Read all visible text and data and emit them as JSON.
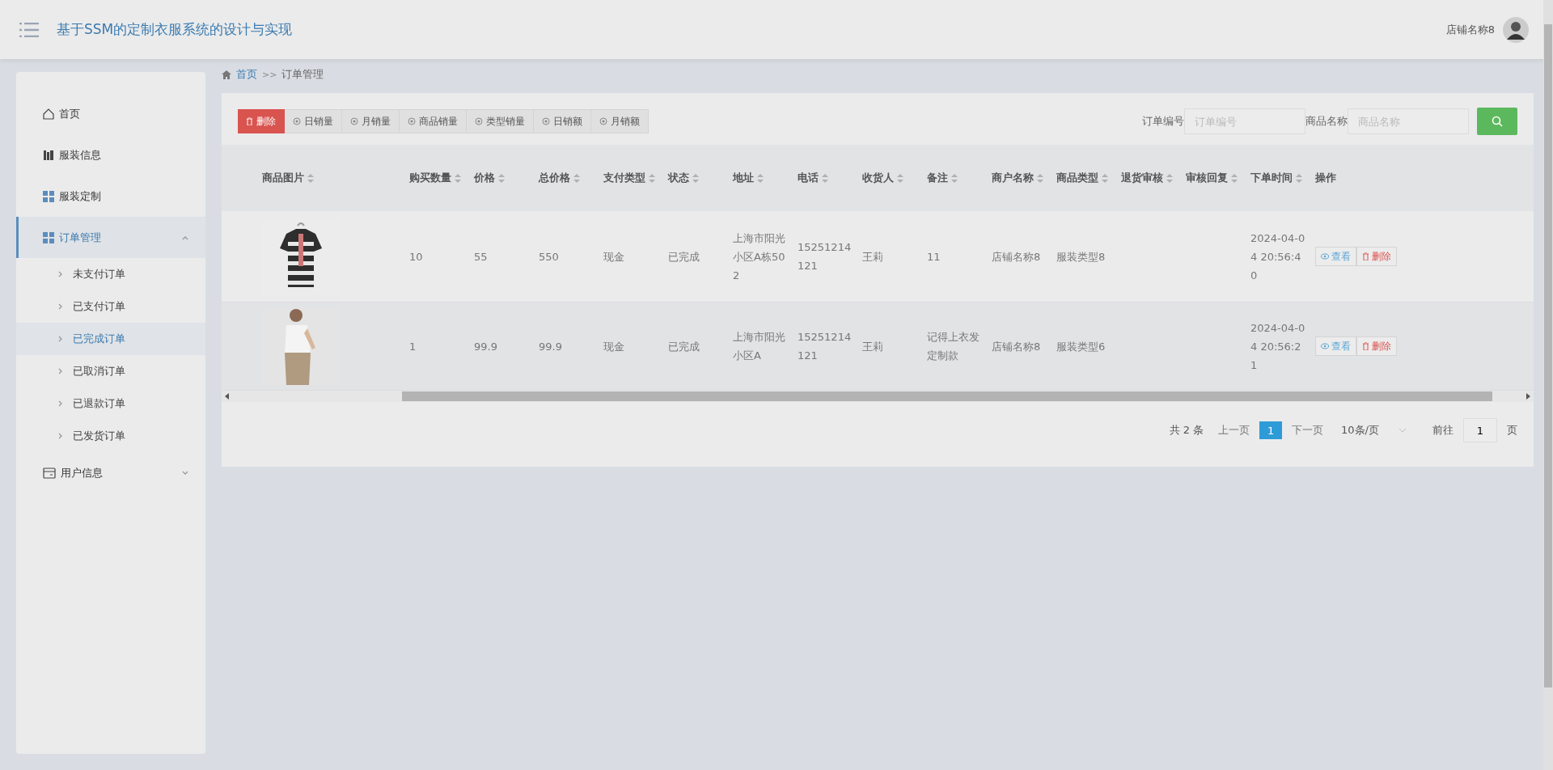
{
  "header": {
    "title": "基于SSM的定制衣服系统的设计与实现",
    "user": "店铺名称8"
  },
  "sidebar": {
    "items": [
      {
        "label": "首页",
        "kind": "link",
        "expanded": false
      },
      {
        "label": "服装信息",
        "kind": "link",
        "expanded": false
      },
      {
        "label": "服装定制",
        "kind": "link",
        "expanded": false
      },
      {
        "label": "订单管理",
        "kind": "menu",
        "expanded": true,
        "children": [
          {
            "label": "未支付订单",
            "selected": false
          },
          {
            "label": "已支付订单",
            "selected": false
          },
          {
            "label": "已完成订单",
            "selected": true
          },
          {
            "label": "已取消订单",
            "selected": false
          },
          {
            "label": "已退款订单",
            "selected": false
          },
          {
            "label": "已发货订单",
            "selected": false
          }
        ]
      },
      {
        "label": "用户信息",
        "kind": "menu",
        "expanded": false
      }
    ]
  },
  "breadcrumb": {
    "home": "首页",
    "separator": ">>",
    "current": "订单管理"
  },
  "toolbar": {
    "buttons": [
      {
        "label": "删除",
        "kind": "danger"
      },
      {
        "label": "日销量",
        "kind": "plain"
      },
      {
        "label": "月销量",
        "kind": "plain"
      },
      {
        "label": "商品销量",
        "kind": "plain"
      },
      {
        "label": "类型销量",
        "kind": "plain"
      },
      {
        "label": "日销额",
        "kind": "plain"
      },
      {
        "label": "月销额",
        "kind": "plain"
      }
    ],
    "filters": [
      {
        "label": "订单编号",
        "placeholder": "订单编号"
      },
      {
        "label": "商品名称",
        "placeholder": "商品名称"
      }
    ]
  },
  "table": {
    "columns": [
      {
        "label": "商品图片",
        "sortable": true
      },
      {
        "label": "购买数量",
        "sortable": true
      },
      {
        "label": "价格",
        "sortable": true
      },
      {
        "label": "总价格",
        "sortable": true
      },
      {
        "label": "支付类型",
        "sortable": true
      },
      {
        "label": "状态",
        "sortable": true
      },
      {
        "label": "地址",
        "sortable": true
      },
      {
        "label": "电话",
        "sortable": true
      },
      {
        "label": "收货人",
        "sortable": true
      },
      {
        "label": "备注",
        "sortable": true
      },
      {
        "label": "商户名称",
        "sortable": true
      },
      {
        "label": "商品类型",
        "sortable": true
      },
      {
        "label": "退货审核",
        "sortable": true
      },
      {
        "label": "审核回复",
        "sortable": true
      },
      {
        "label": "下单时间",
        "sortable": true
      },
      {
        "label": "操作",
        "sortable": false
      }
    ],
    "rows": [
      {
        "cells": [
          {
            "kind": "picture"
          },
          "10",
          "55",
          "550",
          "现金",
          "已完成",
          "上海市阳光小区A栋502",
          "15251214121",
          "王莉",
          "11",
          "店铺名称8",
          "服装类型8",
          "",
          "",
          "2024-04-04 20:56:40",
          {
            "kind": "actions",
            "buttons": [
              "查看",
              "删除"
            ]
          }
        ]
      },
      {
        "cells": [
          {
            "kind": "picture"
          },
          "1",
          "99.9",
          "99.9",
          "现金",
          "已完成",
          "上海市阳光小区A",
          "15251214121",
          "王莉",
          "记得上衣发定制款",
          "店铺名称8",
          "服装类型6",
          "",
          "",
          "2024-04-04 20:56:21",
          {
            "kind": "actions",
            "buttons": [
              "查看",
              "删除"
            ]
          }
        ]
      }
    ]
  },
  "pagination": {
    "total": "共 2 条",
    "prev": "上一页",
    "pages": [
      {
        "label": "1",
        "selected": true
      }
    ],
    "next": "下一页",
    "size": "10条/页",
    "goto": "前往",
    "goto_value": "1",
    "goto_suffix": "页"
  }
}
